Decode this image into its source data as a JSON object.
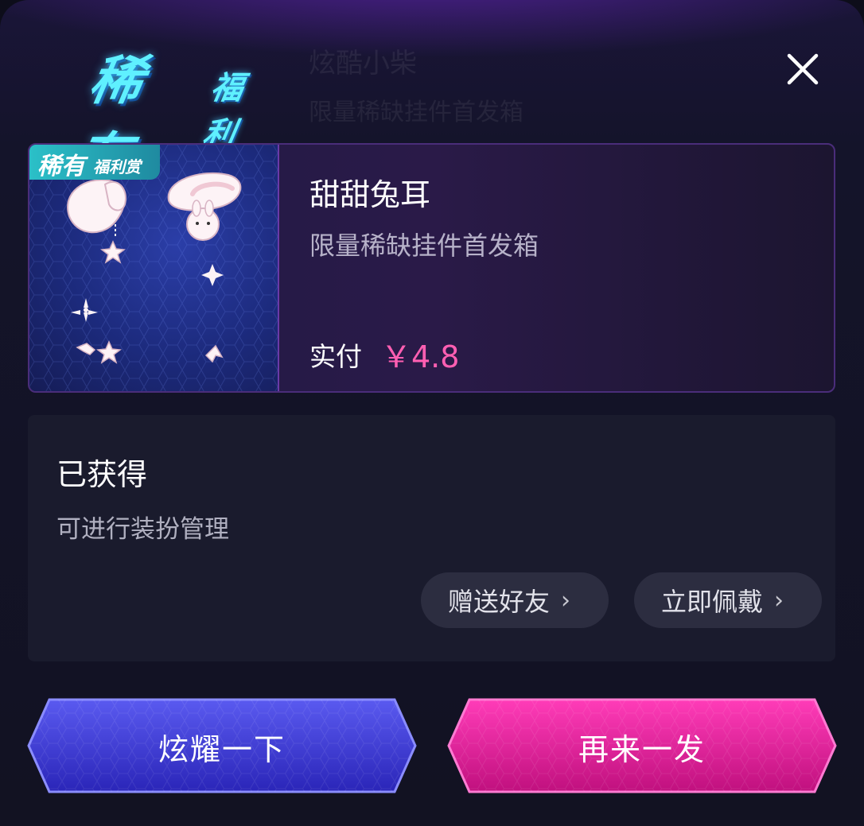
{
  "logo": {
    "big": "稀有",
    "small": "福利赏"
  },
  "background_ghost": {
    "line1": "炫酷小柴",
    "line2": "限量稀缺挂件首发箱"
  },
  "product": {
    "badge_big": "稀有",
    "badge_small": "福利赏",
    "name": "甜甜兔耳",
    "description": "限量稀缺挂件首发箱",
    "pay_label": "实付",
    "price": "￥4.8"
  },
  "obtained": {
    "title": "已获得",
    "subtitle": "可进行装扮管理",
    "gift_button": "赠送好友",
    "wear_button": "立即佩戴",
    "chevron": "›"
  },
  "actions": {
    "show_off": "炫耀一下",
    "again": "再来一发"
  },
  "icons": {
    "close": "close-icon",
    "chevron": "chevron-right-icon"
  },
  "colors": {
    "accent_pink": "#ff5fb2",
    "logo_cyan": "#5ff0ff",
    "show_off_button": "#3a3ad8",
    "again_button": "#e01aa0"
  }
}
